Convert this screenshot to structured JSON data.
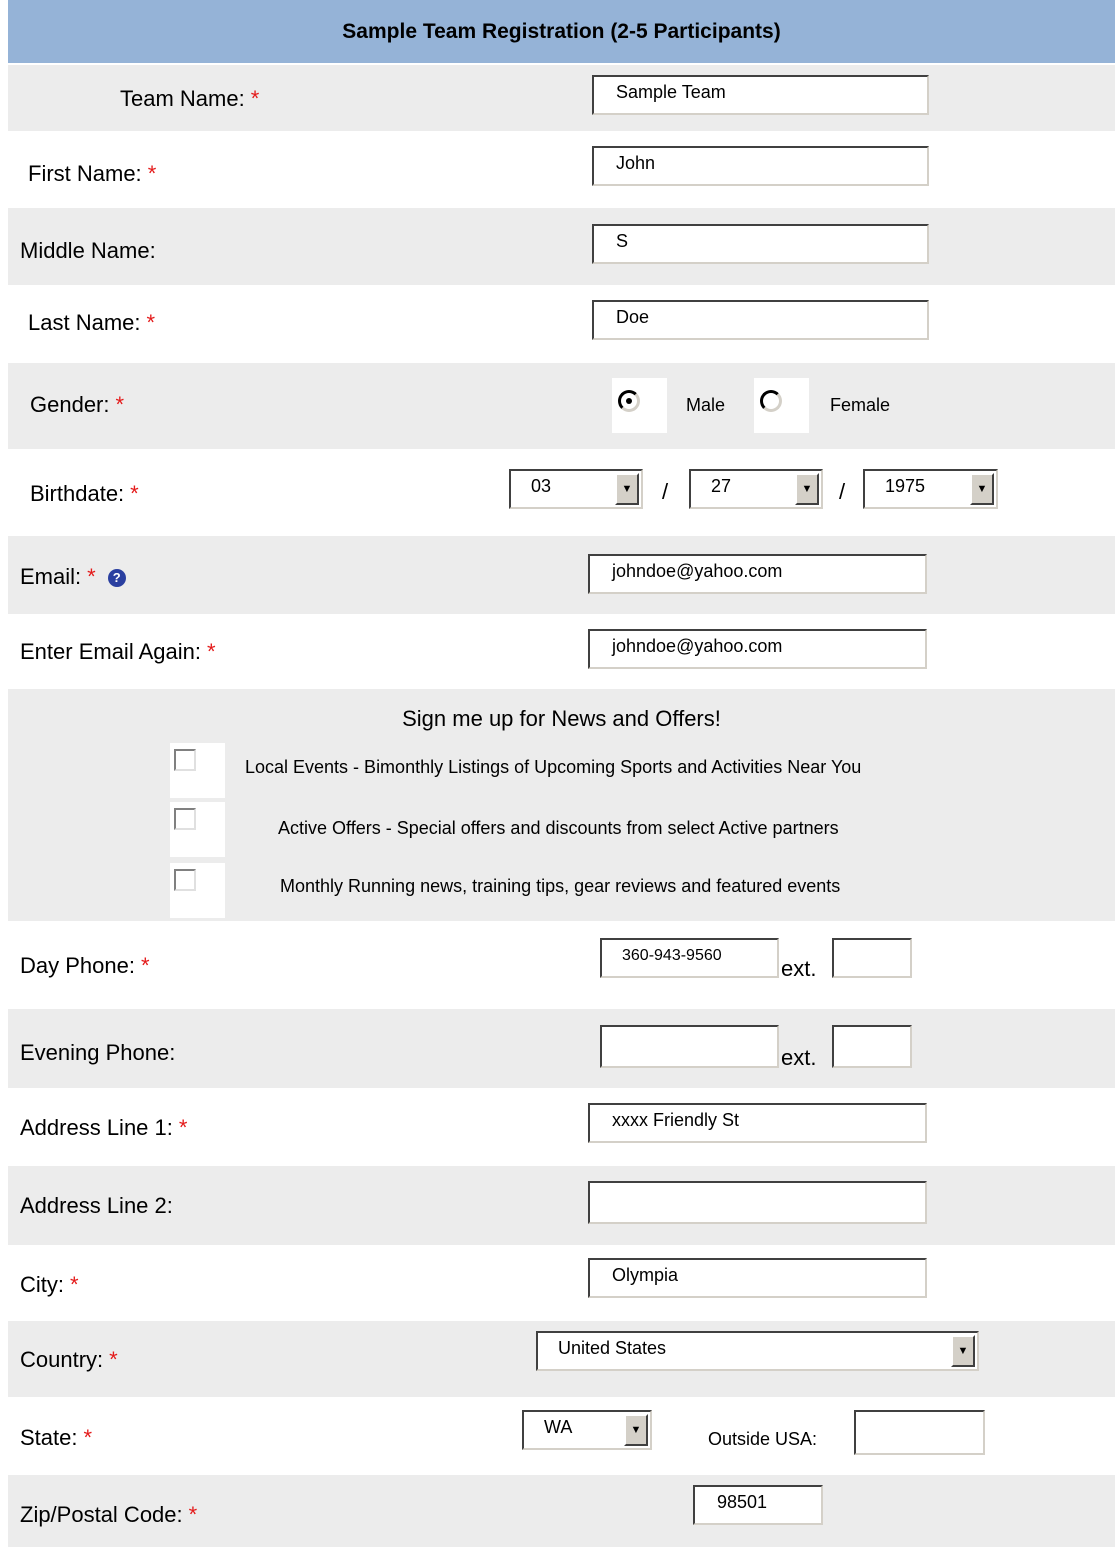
{
  "header": {
    "title": "Sample Team Registration (2-5 Participants)"
  },
  "required_mark": "*",
  "help_icon_glyph": "?",
  "labels": {
    "team_name": "Team Name:",
    "first_name": "First Name:",
    "middle_name": "Middle Name:",
    "last_name": "Last Name:",
    "gender": "Gender:",
    "birthdate": "Birthdate:",
    "email": "Email:",
    "email_again": "Enter Email Again:",
    "day_phone": "Day Phone:",
    "evening_phone": "Evening Phone:",
    "address1": "Address Line 1:",
    "address2": "Address Line 2:",
    "city": "City:",
    "country": "Country:",
    "state": "State:",
    "zip": "Zip/Postal Code:"
  },
  "values": {
    "team_name": "Sample Team",
    "first_name": "John",
    "middle_name": "S",
    "last_name": "Doe",
    "email": "johndoe@yahoo.com",
    "email_again": "johndoe@yahoo.com",
    "day_phone": "360-943-9560",
    "day_phone_ext": "",
    "evening_phone": "",
    "evening_phone_ext": "",
    "address1": "xxxx Friendly St",
    "address2": "",
    "city": "Olympia",
    "country": "United States",
    "state": "WA",
    "outside_usa": "",
    "zip": "98501"
  },
  "gender": {
    "male_label": "Male",
    "female_label": "Female",
    "selected": "male"
  },
  "birthdate": {
    "month": "03",
    "day": "27",
    "year": "1975",
    "separator": "/"
  },
  "ext_label": "ext.",
  "outside_usa_label": "Outside USA:",
  "newsletter": {
    "heading": "Sign me up for News and Offers!",
    "options": [
      {
        "label": "Local Events - Bimonthly Listings of Upcoming Sports and Activities Near You",
        "checked": false
      },
      {
        "label": "Active Offers - Special offers and discounts from select Active partners",
        "checked": false
      },
      {
        "label": "Monthly Running news, training tips, gear reviews and featured events",
        "checked": false
      }
    ]
  },
  "colors": {
    "header_bg": "#95b3d7",
    "row_grey": "#ececec",
    "required": "#e41a1a",
    "help_icon": "#2a3fa0"
  }
}
